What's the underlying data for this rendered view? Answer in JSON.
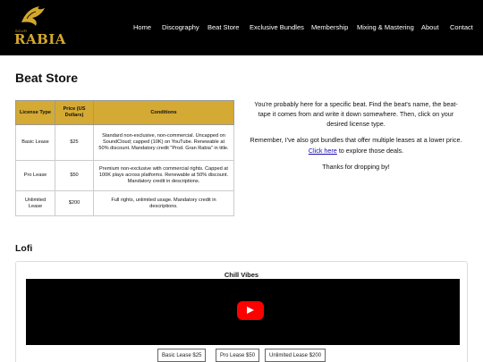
{
  "nav": {
    "logo_small": "SOUR",
    "logo_text": "RABIA",
    "links": [
      "Home",
      "Discography",
      "Beat Store",
      "Exclusive Bundles",
      "Membership",
      "Mixing & Mastering",
      "About",
      "Contact"
    ]
  },
  "page": {
    "title": "Beat Store"
  },
  "table": {
    "headers": [
      "License Type",
      "Price (US Dollars)",
      "Conditions"
    ],
    "rows": [
      {
        "type": "Basic Lease",
        "price": "$25",
        "conditions": "Standard non-exclusive, non-commercial. Uncapped on SoundCloud; capped (10K) on YouTube. Renewable at 50% discount. Mandatory credit \"Prod. Gran Rabia\" in title."
      },
      {
        "type": "Pro Lease",
        "price": "$50",
        "conditions": "Premium non-exclusive with commercial rights. Capped at 100K plays across platforms. Renewable at 50% discount. Mandatory credit in descriptions."
      },
      {
        "type": "Unlimited Lease",
        "price": "$200",
        "conditions": "Full rights, unlimited usage. Mandatory credit in descriptions."
      }
    ]
  },
  "info": {
    "p1": "You're probably here for a specific beat. Find the beat's name, the beat-tape it comes from and write it down somewhere. Then, click on your desired license type.",
    "p2_before": "Remember, I've also got bundles that offer multiple leases at a lower price.",
    "p2_link": "Click here",
    "p2_after": "to explore those deals.",
    "p3": "Thanks for dropping by!"
  },
  "section": {
    "title": "Lofi"
  },
  "beat_card": {
    "title": "Chill Vibes",
    "buttons": [
      "Basic Lease $25",
      "Pro Lease $50",
      "Unlimited Lease $200"
    ]
  },
  "colors": {
    "accent": "#d4aa34",
    "nav_bg": "#000000",
    "play": "#ff0000"
  }
}
